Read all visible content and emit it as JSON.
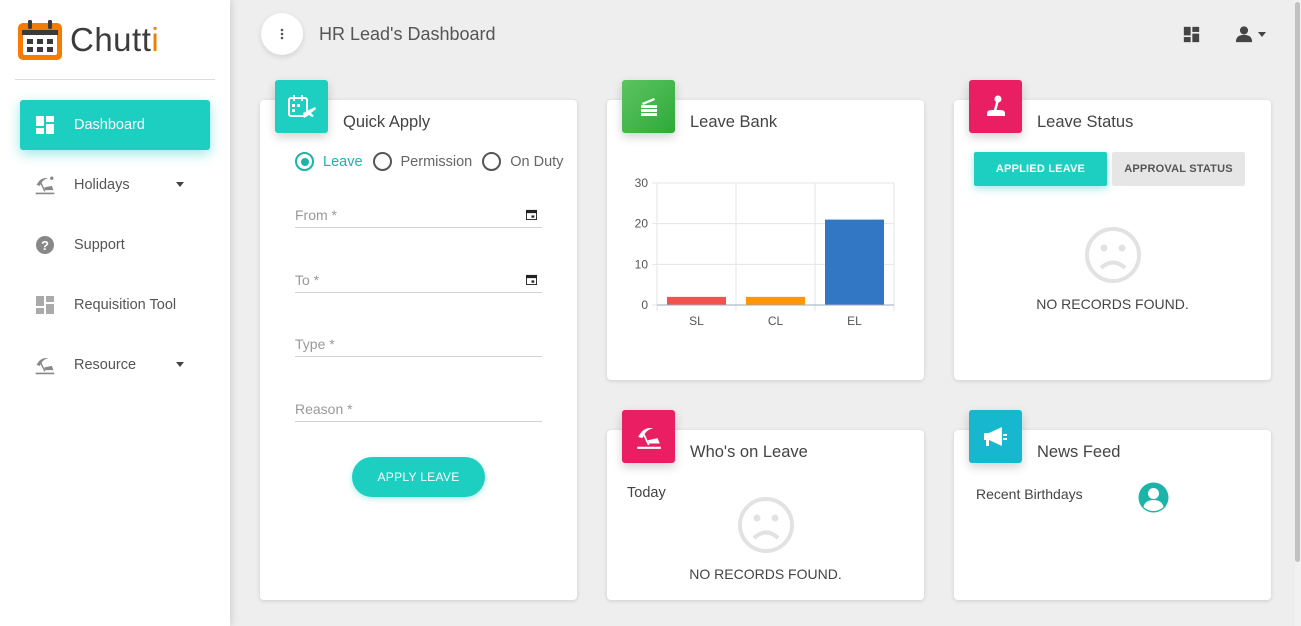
{
  "app": {
    "logo_main": "Chutt",
    "logo_accent": "i"
  },
  "sidebar": {
    "items": [
      {
        "label": "Dashboard",
        "icon": "dashboard-icon",
        "active": true
      },
      {
        "label": "Holidays",
        "icon": "beach-icon",
        "has_dropdown": true
      },
      {
        "label": "Support",
        "icon": "help-icon"
      },
      {
        "label": "Requisition Tool",
        "icon": "dashboard-icon"
      },
      {
        "label": "Resource",
        "icon": "beach-icon",
        "has_dropdown": true
      }
    ]
  },
  "header": {
    "title": "HR Lead's Dashboard"
  },
  "quick_apply": {
    "title": "Quick Apply",
    "radios": [
      "Leave",
      "Permission",
      "On Duty"
    ],
    "selected": "Leave",
    "fields": {
      "from": "From *",
      "to": "To *",
      "type": "Type *",
      "reason": "Reason *"
    },
    "button": "APPLY LEAVE"
  },
  "leave_bank": {
    "title": "Leave Bank"
  },
  "leave_status": {
    "title": "Leave Status",
    "tab_applied": "APPLIED LEAVE",
    "tab_approval": "APPROVAL STATUS",
    "empty": "NO RECORDS FOUND."
  },
  "whos_on_leave": {
    "title": "Who's on Leave",
    "today": "Today",
    "empty": "NO RECORDS FOUND."
  },
  "news_feed": {
    "title": "News Feed",
    "birthdays": "Recent Birthdays"
  },
  "colors": {
    "accent": "#1ccfc1",
    "sl": "#ef5350",
    "cl": "#ff9800",
    "el": "#3277c4"
  },
  "chart_data": {
    "type": "bar",
    "title": "",
    "xlabel": "",
    "ylabel": "",
    "categories": [
      "SL",
      "CL",
      "EL"
    ],
    "values": [
      2,
      2,
      21
    ],
    "ylim": [
      0,
      30
    ],
    "yticks": [
      0,
      10,
      20,
      30
    ],
    "grid": true
  }
}
